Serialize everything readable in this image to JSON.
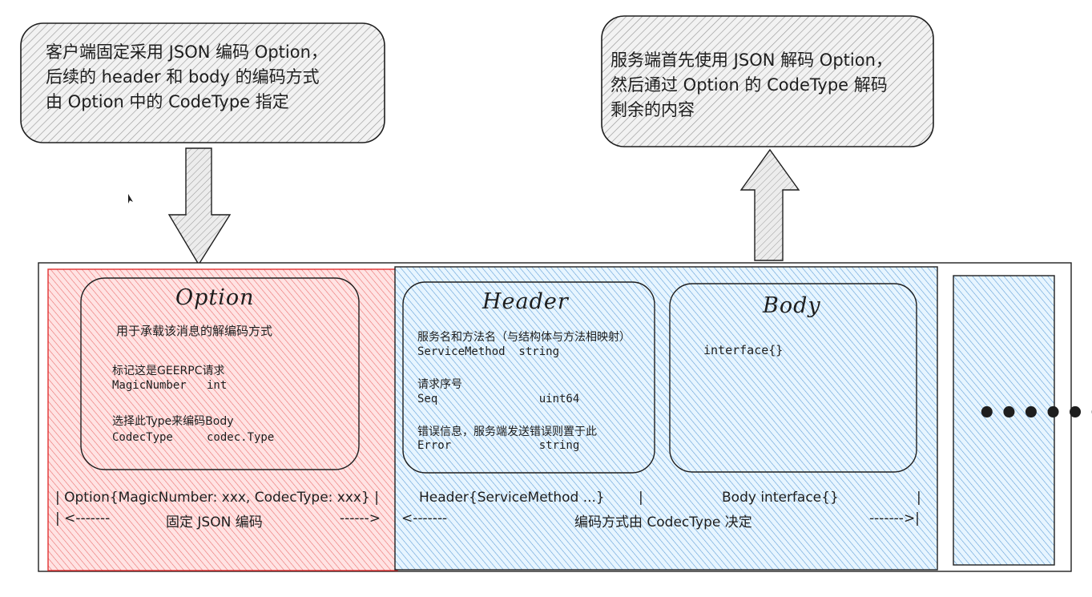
{
  "colors": {
    "stroke": "#1e1e1e",
    "callout_fill": "#9a9a9a",
    "red_fill": "#ffc9c9",
    "red_hatch": "#e03131",
    "blue_fill": "#a5d8ff",
    "blue_hatch": "#1971c2",
    "arrow_fill": "#d0d0d0"
  },
  "callouts": {
    "client": {
      "line1": "客户端固定采用 JSON 编码 Option，",
      "line2": "后续的 header 和 body 的编码方式",
      "line3": "由 Option 中的 CodeType 指定"
    },
    "server": {
      "line1": "服务端首先使用 JSON 解码 Option，",
      "line2": "然后通过 Option 的 CodeType 解码",
      "line3": "剩余的内容"
    }
  },
  "option": {
    "title": "Option",
    "subtitle": "用于承载该消息的解编码方式",
    "fields": [
      {
        "desc": "标记这是GEERPC请求",
        "decl": "MagicNumber   int"
      },
      {
        "desc": "选择此Type来编码Body",
        "decl": "CodecType     codec.Type"
      }
    ]
  },
  "header": {
    "title": "Header",
    "fields": [
      {
        "desc": "服务名和方法名（与结构体与方法相映射）",
        "decl": "ServiceMethod  string"
      },
      {
        "desc": "请求序号",
        "decl": "Seq               uint64"
      },
      {
        "desc": "错误信息，服务端发送错误则置于此",
        "decl": "Error             string"
      }
    ]
  },
  "body": {
    "title": "Body",
    "content": "interface{}"
  },
  "more": {
    "label": "••••••"
  },
  "footer": {
    "option_struct": "| Option{MagicNumber: xxx, CodecType: xxx} |",
    "option_arrow_left": "| <-------",
    "option_encoding": "固定 JSON 编码",
    "option_arrow_right": "------>",
    "header_struct": "Header{ServiceMethod ...}",
    "separator": "|",
    "body_struct": "Body interface{}",
    "end_bar": "|",
    "rest_arrow_left": "<-------",
    "rest_encoding": "编码方式由 CodecType 决定",
    "rest_arrow_right": "------->|"
  }
}
